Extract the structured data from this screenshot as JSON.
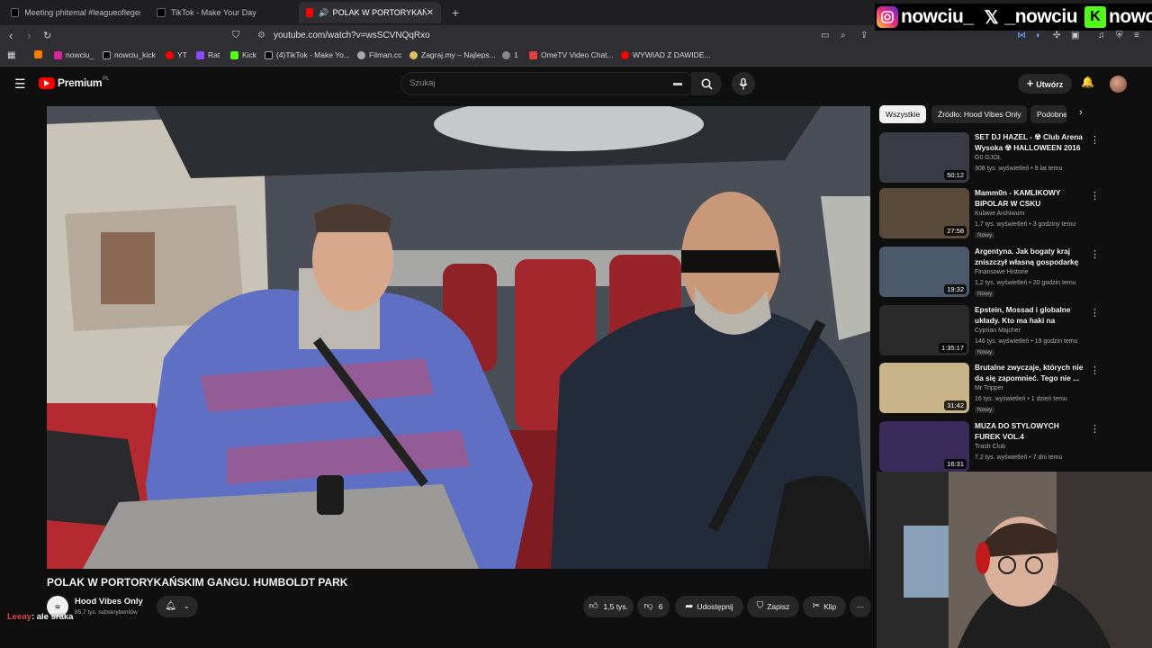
{
  "browser": {
    "tabs": [
      {
        "label": "Meeting phitemal #leagueoflegends",
        "icon": "tiktok-icon"
      },
      {
        "label": "TikTok - Make Your Day",
        "icon": "tiktok-icon"
      },
      {
        "label": "POLAK W PORTORYKAŃSKIM",
        "icon": "youtube-icon",
        "active": true
      }
    ],
    "url": "youtube.com/watch?v=wsSCVNQqRxo",
    "bookmarks": [
      {
        "label": "",
        "color": "#f57c00"
      },
      {
        "label": "nowciu_",
        "color": "#d6249f"
      },
      {
        "label": "nowciu_kick",
        "color": "#ffffff"
      },
      {
        "label": "YT",
        "color": "#ff0000"
      },
      {
        "label": "Rat",
        "color": "#9146ff"
      },
      {
        "label": "Kick",
        "color": "#53fc18"
      },
      {
        "label": "(4)TikTok - Make Yo...",
        "color": "#ffffff"
      },
      {
        "label": "Filman.cc",
        "color": "#aaaaaa"
      },
      {
        "label": "Zagraj.my – Najleps...",
        "color": "#e0c060"
      },
      {
        "label": "1",
        "color": "#888888"
      },
      {
        "label": "OmeTV Video Chat...",
        "color": "#e04040"
      },
      {
        "label": "WYWIAD Z DAWIDE...",
        "color": "#ff0000"
      }
    ]
  },
  "overlay": {
    "social": [
      {
        "handle": "nowciu_",
        "icon": "instagram-icon"
      },
      {
        "handle": "_nowciu",
        "icon": "x-icon"
      },
      {
        "handle": "nowciu",
        "icon": "kick-icon"
      }
    ],
    "chat": {
      "user": "Leeay",
      "message": ": ale sraka"
    }
  },
  "youtube": {
    "logo": "Premium",
    "logo_badge": "PL",
    "search_placeholder": "Szukaj",
    "create_label": "Utwórz",
    "video": {
      "title": "POLAK W PORTORYKAŃSKIM GANGU. HUMBOLDT PARK",
      "channel": "Hood Vibes Only",
      "subscribers": "85,7 tys. subskrybentów",
      "likes": "1,5 tys.",
      "dislikes": "6",
      "share": "Udostępnij",
      "save": "Zapisz",
      "clip": "Klip"
    },
    "chips": [
      "Wszystkie",
      "Źródło: Hood Vibes Only",
      "Podobne"
    ],
    "recommended": [
      {
        "title": "SET DJ HAZEL - ☢ Club Arena Wysoka ☢ HALLOWEEN 2016 ...",
        "channel": "G0 GJOL",
        "meta": "308 tys. wyświetleń • 9 lat temu",
        "duration": "50:12",
        "new": "",
        "thumb": "#3a3a44"
      },
      {
        "title": "Mamm0n - KAMLIKOWY BIPOLAR W CSKU",
        "channel": "Kulawe Archiwum",
        "meta": "1,7 tys. wyświetleń • 3 godziny temu",
        "duration": "27:58",
        "new": "Nowy",
        "thumb": "#5a4a3a"
      },
      {
        "title": "Argentyna. Jak bogaty kraj zniszczył własną gospodarkę",
        "channel": "Finansowe Historie",
        "meta": "1,2 tys. wyświetleń • 20 godzin temu",
        "duration": "19:32",
        "new": "Nowy",
        "thumb": "#4a5a6a"
      },
      {
        "title": "Epstein, Mossad i globalne układy. Kto ma haki na polskie...",
        "channel": "Cyprian Majcher",
        "meta": "146 tys. wyświetleń • 19 godzin temu",
        "duration": "1:35:17",
        "new": "Nowy",
        "thumb": "#2a2a2a"
      },
      {
        "title": "Brutalne zwyczaje, których nie da się zapomnieć. Tego nie ...",
        "channel": "Mr Tripper",
        "meta": "16 tys. wyświetleń • 1 dzień temu",
        "duration": "31:42",
        "new": "Nowy",
        "thumb": "#c9b48a"
      },
      {
        "title": "MUZA DO STYLOWYCH FUREK VOL.4",
        "channel": "Trash Club",
        "meta": "7,2 tys. wyświetleń • 7 dni temu",
        "duration": "16:31",
        "new": "",
        "thumb": "#3a2a5a"
      }
    ]
  }
}
